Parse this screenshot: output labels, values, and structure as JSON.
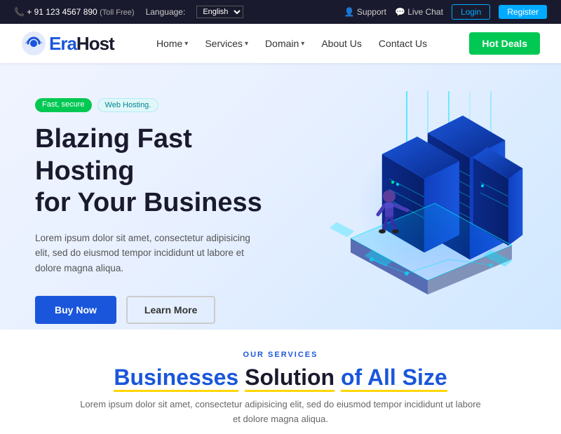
{
  "topbar": {
    "phone": "+ 91 123 4567 890",
    "toll_free": "(Toll Free)",
    "language_label": "Language:",
    "language_value": "English",
    "support": "Support",
    "livechat": "Live Chat",
    "login": "Login",
    "register": "Register"
  },
  "navbar": {
    "logo_text": "raHost",
    "nav_items": [
      {
        "label": "Home",
        "has_arrow": true
      },
      {
        "label": "Services",
        "has_arrow": true
      },
      {
        "label": "Domain",
        "has_arrow": true
      },
      {
        "label": "About Us",
        "has_arrow": false
      },
      {
        "label": "Contact Us",
        "has_arrow": false
      }
    ],
    "hot_deals": "Hot Deals"
  },
  "hero": {
    "badge1": "Fast, secure",
    "badge2": "Web Hosting.",
    "title_line1": "Blazing Fast Hosting",
    "title_line2": "for Your Business",
    "description": "Lorem ipsum dolor sit amet, consectetur adipisicing elit, sed do eiusmod tempor incididunt ut labore et dolore magna aliqua.",
    "btn_buy": "Buy Now",
    "btn_learn": "Learn More"
  },
  "services": {
    "label": "OUR SERVICES",
    "title_normal": "Businesses",
    "title_highlight": "Solution",
    "title_end": "of All Size",
    "description": "Lorem ipsum dolor sit amet, consectetur adipisicing elit, sed do eiusmod tempor incididunt ut labore et dolore magna aliqua."
  }
}
